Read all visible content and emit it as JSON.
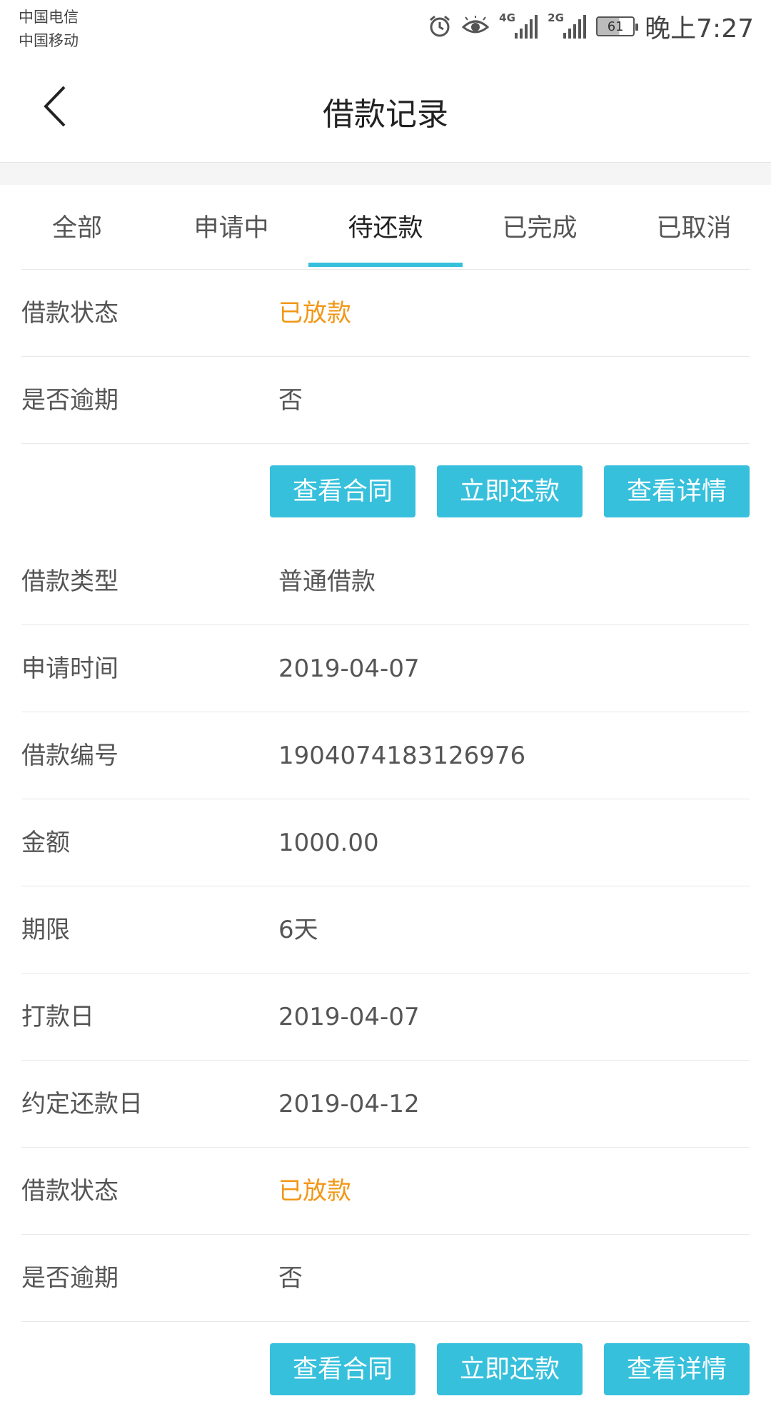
{
  "status_bar": {
    "carrier1": "中国电信",
    "carrier2": "中国移动",
    "network1": "4G",
    "network2": "2G",
    "battery": "61",
    "time": "晚上7:27",
    "icons": [
      "alarm-icon",
      "eye-icon",
      "signal-4g-icon",
      "signal-2g-icon",
      "battery-icon"
    ]
  },
  "header": {
    "title": "借款记录",
    "back_icon": "chevron-left-icon"
  },
  "tabs": [
    {
      "label": "全部"
    },
    {
      "label": "申请中"
    },
    {
      "label": "待还款",
      "active": true
    },
    {
      "label": "已完成"
    },
    {
      "label": "已取消"
    }
  ],
  "colors": {
    "accent": "#37c0dc",
    "status_orange": "#f29717"
  },
  "records": [
    {
      "fields": [
        {
          "label": "借款状态",
          "value": "已放款"
        },
        {
          "label": "是否逾期",
          "value": "否"
        }
      ],
      "buttons": [
        "查看合同",
        "立即还款",
        "查看详情"
      ]
    },
    {
      "fields": [
        {
          "label": "借款类型",
          "value": "普通借款"
        },
        {
          "label": "申请时间",
          "value": "2019-04-07"
        },
        {
          "label": "借款编号",
          "value": "1904074183126976"
        },
        {
          "label": "金额",
          "value": "1000.00"
        },
        {
          "label": "期限",
          "value": "6天"
        },
        {
          "label": "打款日",
          "value": "2019-04-07"
        },
        {
          "label": "约定还款日",
          "value": "2019-04-12"
        },
        {
          "label": "借款状态",
          "value": "已放款"
        },
        {
          "label": "是否逾期",
          "value": "否"
        }
      ],
      "buttons": [
        "查看合同",
        "立即还款",
        "查看详情"
      ]
    }
  ]
}
